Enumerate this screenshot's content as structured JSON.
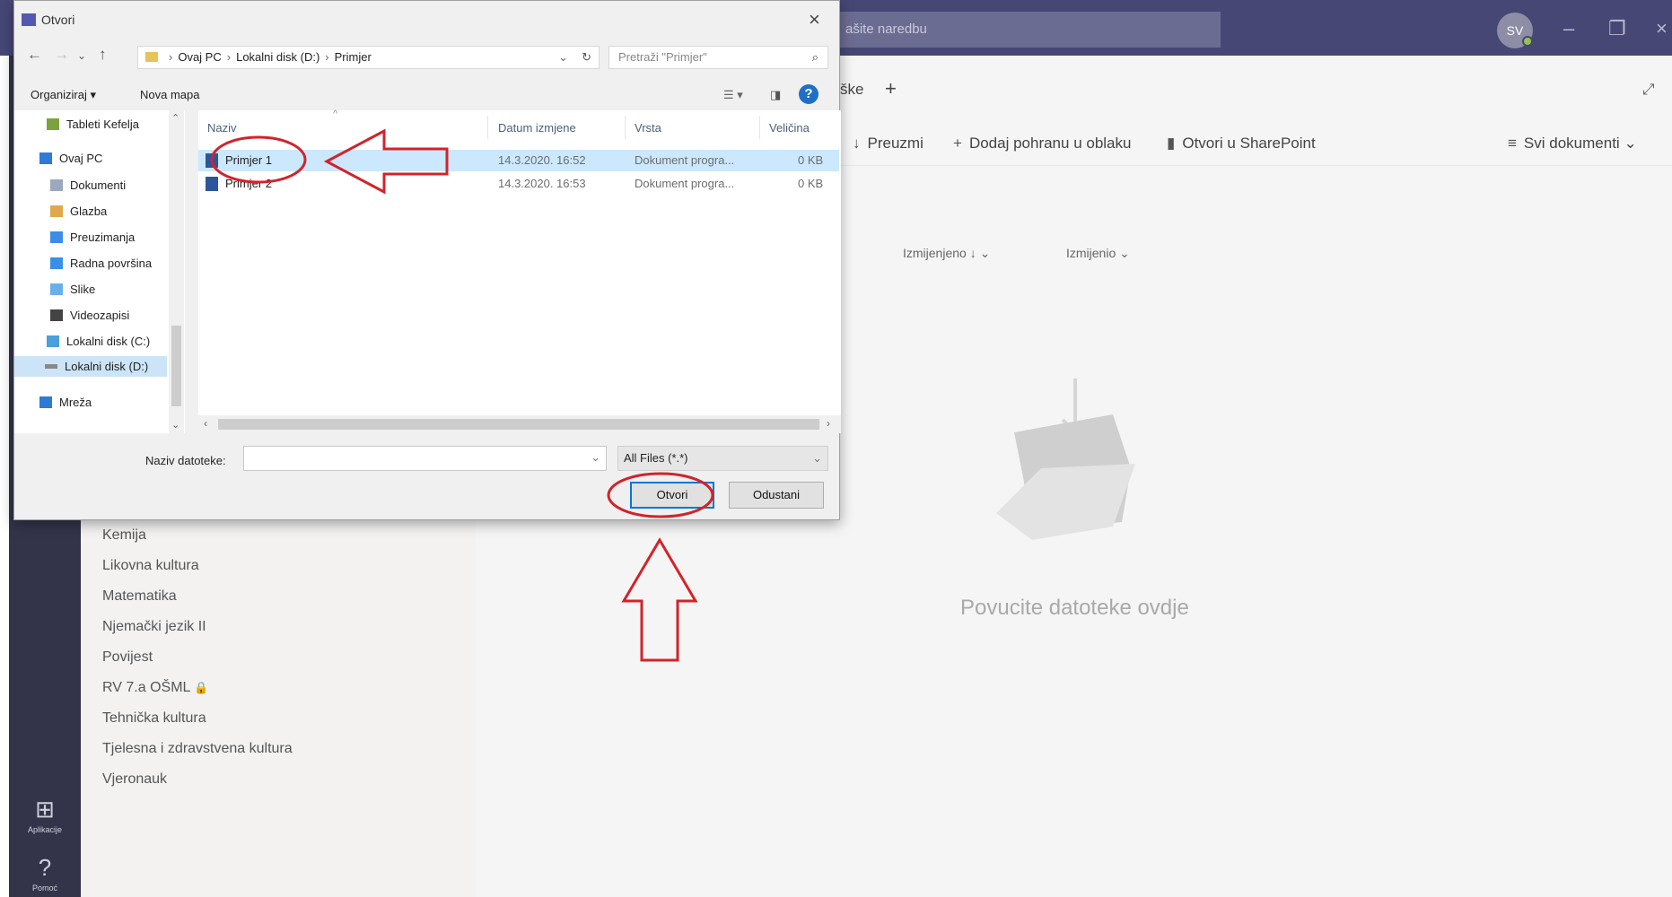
{
  "teams": {
    "search_placeholder": "ašite naredbu",
    "avatar_initials": "SV",
    "tab_partial": "ške",
    "tab_add": "+",
    "commands": [
      {
        "icon": "download-icon",
        "glyph": "↓",
        "label": "Preuzmi"
      },
      {
        "icon": "plus-icon",
        "glyph": "+",
        "label": "Dodaj pohranu u oblaku"
      },
      {
        "icon": "sharepoint-icon",
        "glyph": "▮",
        "label": "Otvori u SharePoint"
      },
      {
        "icon": "menu-icon",
        "glyph": "≡",
        "label": "Svi dokumenti"
      }
    ],
    "columns": [
      "Izmijenjeno ↓",
      "Izmijenio"
    ],
    "empty_message": "Povucite datoteke ovdje",
    "channels": [
      "Kemija",
      "Likovna kultura",
      "Matematika",
      "Njemački jezik II",
      "Povijest",
      "RV 7.a OŠML",
      "Tehnička kultura",
      "Tjelesna i zdravstvena kultura",
      "Vjeronauk"
    ],
    "rail": [
      {
        "icon": "apps-icon",
        "glyph": "⊞",
        "label": "Aplikacije"
      },
      {
        "icon": "help-icon",
        "glyph": "?",
        "label": "Pomoć"
      }
    ]
  },
  "dialog": {
    "title": "Otvori",
    "path": [
      "Ovaj PC",
      "Lokalni disk (D:)",
      "Primjer"
    ],
    "search_placeholder": "Pretraži \"Primjer\"",
    "toolbar": {
      "organize": "Organiziraj ▾",
      "new_folder": "Nova mapa"
    },
    "nav_items": [
      {
        "label": "Tableti Kefelja",
        "color": "#7aa33d"
      },
      {
        "label": "Ovaj PC",
        "color": "#2d7bd6"
      },
      {
        "label": "Dokumenti",
        "color": "#9aa9bd"
      },
      {
        "label": "Glazba",
        "color": "#e0a84b"
      },
      {
        "label": "Preuzimanja",
        "color": "#3a8ee6"
      },
      {
        "label": "Radna površina",
        "color": "#3a8ee6"
      },
      {
        "label": "Slike",
        "color": "#6ab0e8"
      },
      {
        "label": "Videozapisi",
        "color": "#444444"
      },
      {
        "label": "Lokalni disk (C:)",
        "color": "#4aa0d8"
      },
      {
        "label": "Lokalni disk (D:)",
        "color": "#888888"
      },
      {
        "label": "Mreža",
        "color": "#2d7bd6"
      }
    ],
    "columns": [
      "Naziv",
      "Datum izmjene",
      "Vrsta",
      "Veličina"
    ],
    "files": [
      {
        "name": "Primjer 1",
        "date": "14.3.2020. 16:52",
        "type": "Dokument progra...",
        "size": "0 KB"
      },
      {
        "name": "Primjer 2",
        "date": "14.3.2020. 16:53",
        "type": "Dokument progra...",
        "size": "0 KB"
      }
    ],
    "filename_label": "Naziv datoteke:",
    "filename_value": "",
    "filetype": "All Files (*.*)",
    "open_button": "Otvori",
    "cancel_button": "Odustani"
  },
  "colors": {
    "teams_purple": "#464775",
    "annotation_red": "#d2232a",
    "accent_blue": "#0078d7"
  }
}
